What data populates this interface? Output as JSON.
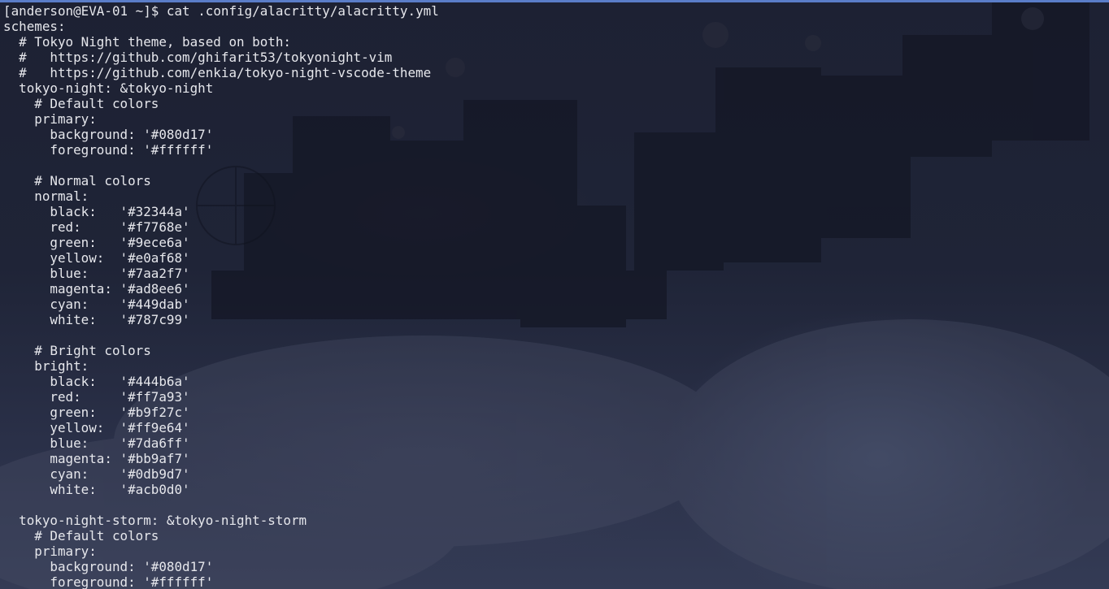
{
  "terminal": {
    "prompt": "[anderson@EVA-01 ~]$ ",
    "command": "cat .config/alacritty/alacritty.yml",
    "output_lines": [
      "schemes:",
      "  # Tokyo Night theme, based on both:",
      "  #   https://github.com/ghifarit53/tokyonight-vim",
      "  #   https://github.com/enkia/tokyo-night-vscode-theme",
      "  tokyo-night: &tokyo-night",
      "    # Default colors",
      "    primary:",
      "      background: '#080d17'",
      "      foreground: '#ffffff'",
      "",
      "    # Normal colors",
      "    normal:",
      "      black:   '#32344a'",
      "      red:     '#f7768e'",
      "      green:   '#9ece6a'",
      "      yellow:  '#e0af68'",
      "      blue:    '#7aa2f7'",
      "      magenta: '#ad8ee6'",
      "      cyan:    '#449dab'",
      "      white:   '#787c99'",
      "",
      "    # Bright colors",
      "    bright:",
      "      black:   '#444b6a'",
      "      red:     '#ff7a93'",
      "      green:   '#b9f27c'",
      "      yellow:  '#ff9e64'",
      "      blue:    '#7da6ff'",
      "      magenta: '#bb9af7'",
      "      cyan:    '#0db9d7'",
      "      white:   '#acb0d0'",
      "",
      "  tokyo-night-storm: &tokyo-night-storm",
      "    # Default colors",
      "    primary:",
      "      background: '#080d17'",
      "      foreground: '#ffffff'"
    ]
  },
  "colors": {
    "text": "#e6e7ec",
    "window_border": "#5a7dc8",
    "background": "#1d2133"
  }
}
